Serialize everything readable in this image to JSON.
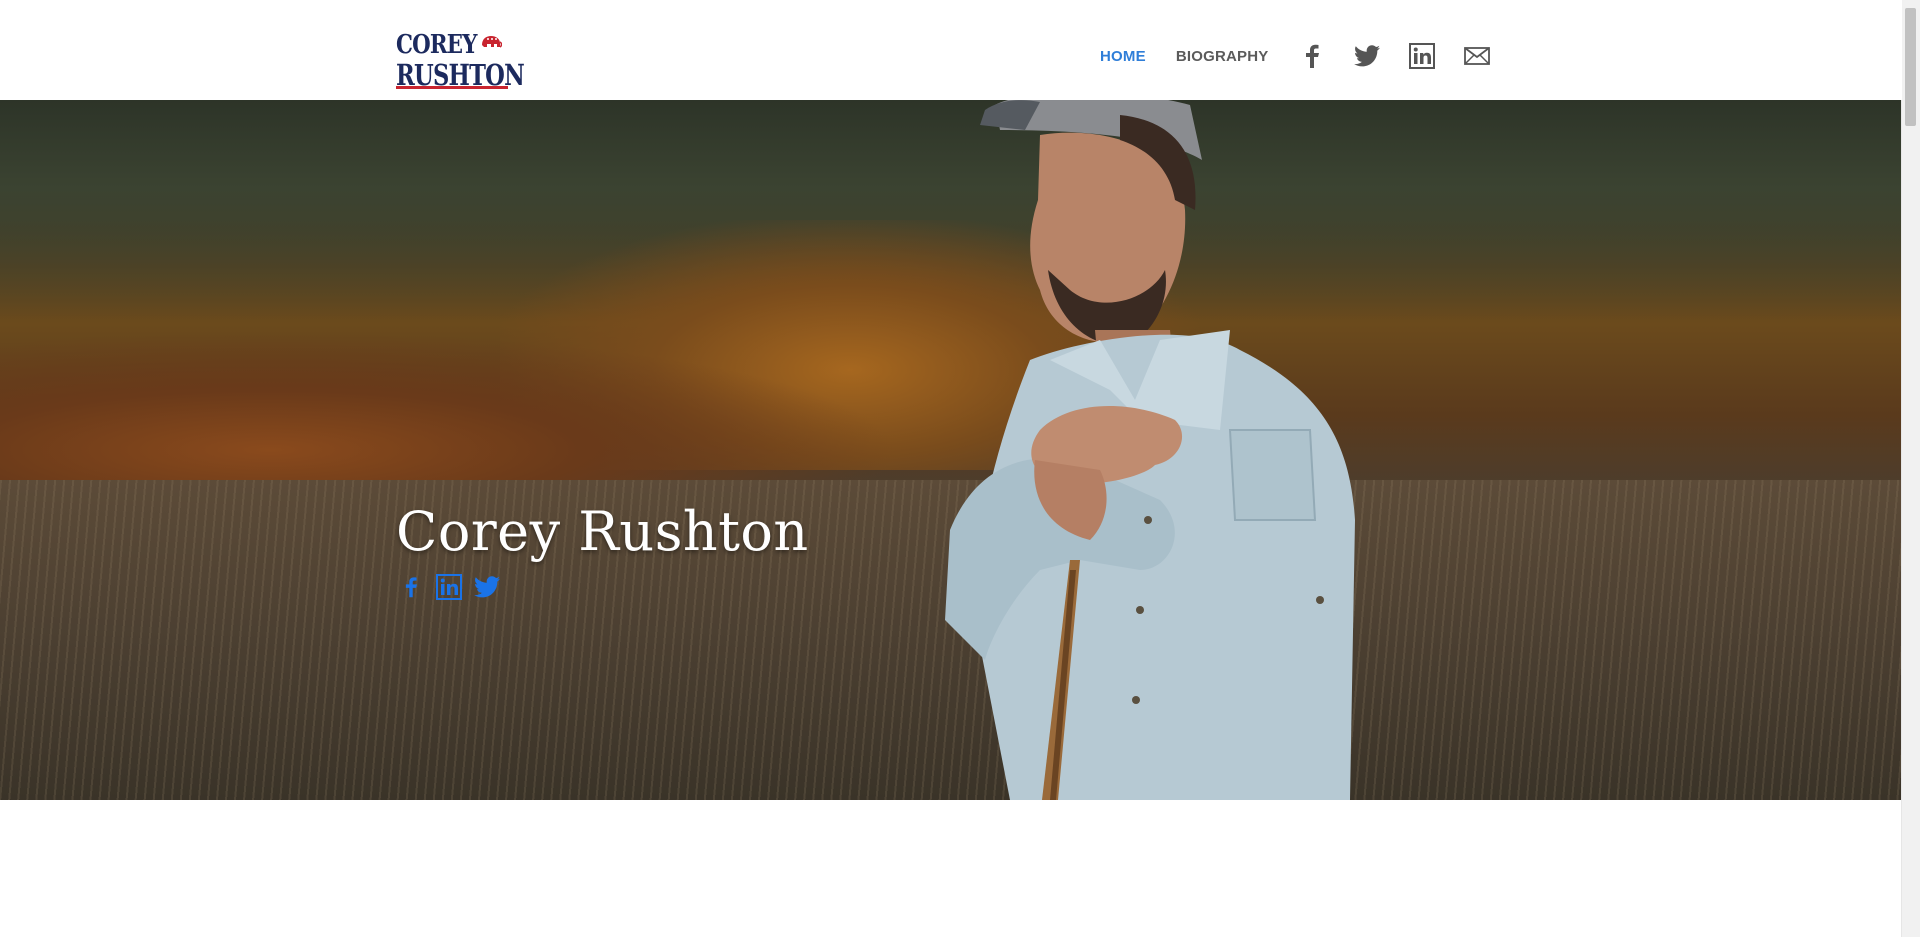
{
  "logo": {
    "line1": "COREY",
    "line2": "RUSHTON",
    "mark_icon": "elephant-icon",
    "colors": {
      "text": "#1c2a5e",
      "accent": "#c8242f"
    }
  },
  "nav": {
    "links": [
      {
        "label": "HOME",
        "active": true
      },
      {
        "label": "BIOGRAPHY",
        "active": false
      }
    ],
    "icons": [
      "facebook-icon",
      "twitter-icon",
      "linkedin-icon",
      "email-icon"
    ],
    "active_color": "#2f7ed8",
    "text_color": "#5b5b5b"
  },
  "hero": {
    "title": "Corey Rushton",
    "social_icons": [
      "facebook-icon",
      "linkedin-icon",
      "twitter-icon"
    ],
    "social_color": "#1a73e8"
  }
}
